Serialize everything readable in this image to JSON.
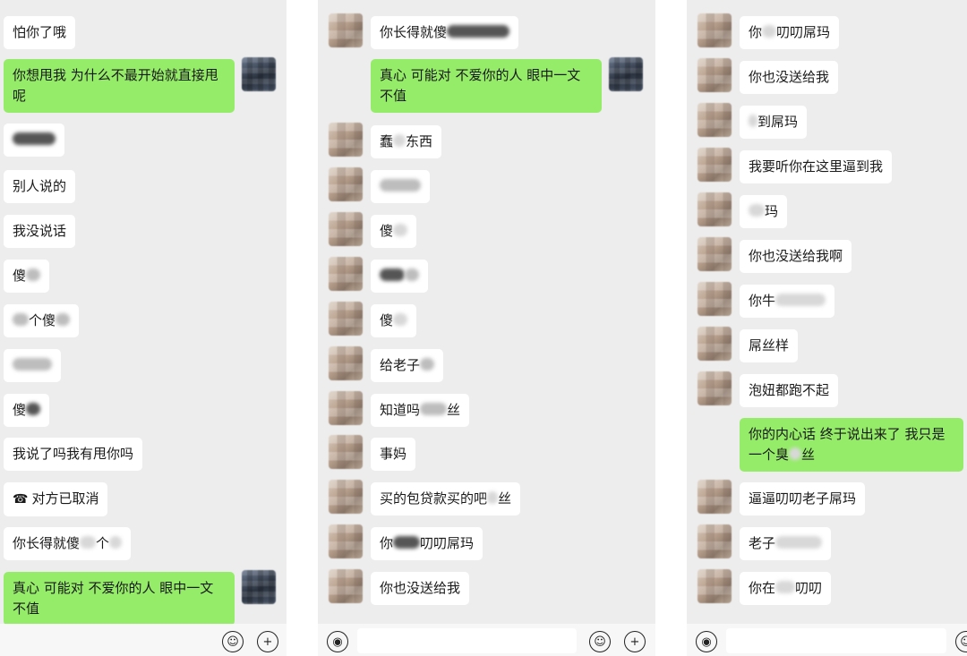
{
  "panel1": {
    "m1": "怕你了哦",
    "m2": "你想甩我 为什么不最开始就直接甩呢",
    "m4": "别人说的",
    "m5": "我没说话",
    "m6": "傻",
    "m7": "个傻",
    "m9": "傻",
    "m10": "我说了吗我有甩你吗",
    "m11": "对方已取消",
    "m12a": "你长得就傻",
    "m12b": "个",
    "m13": "真心 可能对 不爱你的人 眼中一文不值"
  },
  "panel2": {
    "m1": "你长得就傻",
    "m2": "真心 可能对 不爱你的人 眼中一文不值",
    "m3a": "蠢",
    "m3b": "东西",
    "m5": "傻",
    "m7": "傻",
    "m8": "给老子",
    "m9a": "知道吗",
    "m9b": "丝",
    "m10": "事妈",
    "m11a": "买的包贷款买的吧",
    "m11b": "丝",
    "m12a": "你",
    "m12b": "叨叨屌玛",
    "m13": "你也没送给我"
  },
  "panel3": {
    "m1a": "你",
    "m1b": "叨叨屌玛",
    "m2": "你也没送给我",
    "m3": "到屌玛",
    "m4": "我要听你在这里逼到我",
    "m5": "玛",
    "m6": "你也没送给我啊",
    "m7": "你牛",
    "m8": "屌丝样",
    "m9": "泡妞都跑不起",
    "m10a": "你的内心话 终于说出来了 我只是一个臭",
    "m10b": "丝",
    "m11": "逼逼叨叨老子屌玛",
    "m12": "老子",
    "m13a": "你在",
    "m13b": "叨叨"
  },
  "icons": {
    "emoji": "☺",
    "plus": "+",
    "voice": "◉",
    "call_cancel": "☎"
  },
  "colors": {
    "background": "#ededed",
    "bubble_in": "#ffffff",
    "bubble_out": "#95ec69",
    "text": "#191919"
  }
}
